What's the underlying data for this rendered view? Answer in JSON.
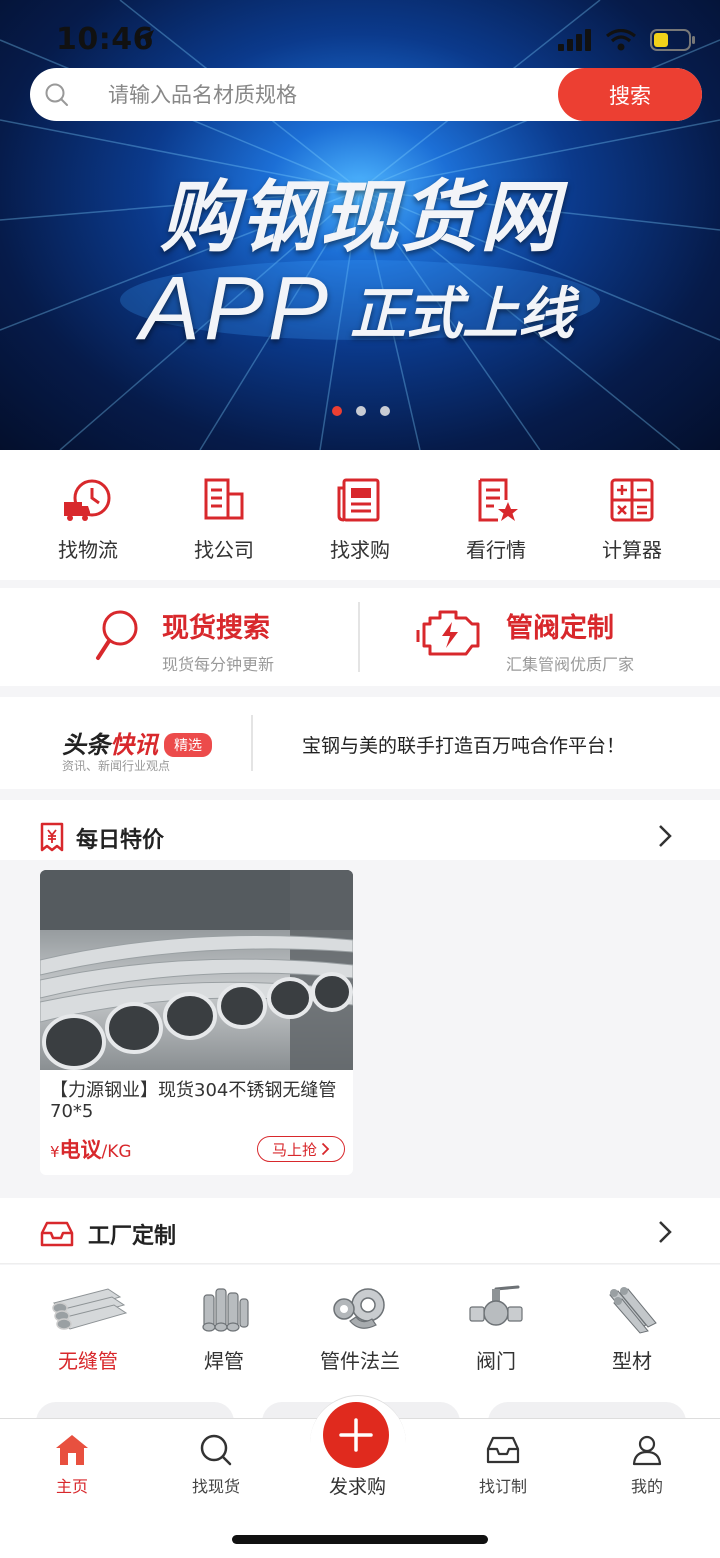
{
  "status": {
    "time": "10:46"
  },
  "search": {
    "placeholder": "请输入品名材质规格",
    "button_label": "搜索"
  },
  "banner": {
    "title": "购钢现货网",
    "app": "APP",
    "subtitle": "正式上线",
    "slide_count": 3,
    "active_slide": 1
  },
  "quick_nav": [
    {
      "label": "找物流",
      "icon": "truck-clock-icon"
    },
    {
      "label": "找公司",
      "icon": "building-icon"
    },
    {
      "label": "找求购",
      "icon": "newspaper-icon"
    },
    {
      "label": "看行情",
      "icon": "document-star-icon"
    },
    {
      "label": "计算器",
      "icon": "calculator-icon"
    }
  ],
  "featured": [
    {
      "title": "现货搜索",
      "subtitle": "现货每分钟更新",
      "icon": "magnifier-icon"
    },
    {
      "title": "管阀定制",
      "subtitle": "汇集管阀优质厂家",
      "icon": "engine-icon"
    }
  ],
  "news": {
    "logo_black": "头条",
    "logo_red": "快讯",
    "badge": "精选",
    "tagline": "资讯、新闻行业观点",
    "headline": "宝钢与美的联手打造百万吨合作平台！"
  },
  "daily_deals": {
    "title": "每日特价",
    "items": [
      {
        "name": "【力源钢业】现货304不锈钢无缝管 70*5",
        "currency": "¥",
        "price": "电议",
        "unit": "/KG",
        "button": "马上抢"
      }
    ]
  },
  "factory": {
    "title": "工厂定制",
    "categories": [
      {
        "label": "无缝管",
        "active": true
      },
      {
        "label": "焊管",
        "active": false
      },
      {
        "label": "管件法兰",
        "active": false
      },
      {
        "label": "阀门",
        "active": false
      },
      {
        "label": "型材",
        "active": false
      }
    ]
  },
  "tabbar": {
    "home": "主页",
    "find_stock": "找现货",
    "publish": "发求购",
    "find_custom": "找订制",
    "mine": "我的"
  },
  "colors": {
    "accent": "#d8282c",
    "search_button": "#ec3f32",
    "publish_button": "#e02a1e"
  }
}
